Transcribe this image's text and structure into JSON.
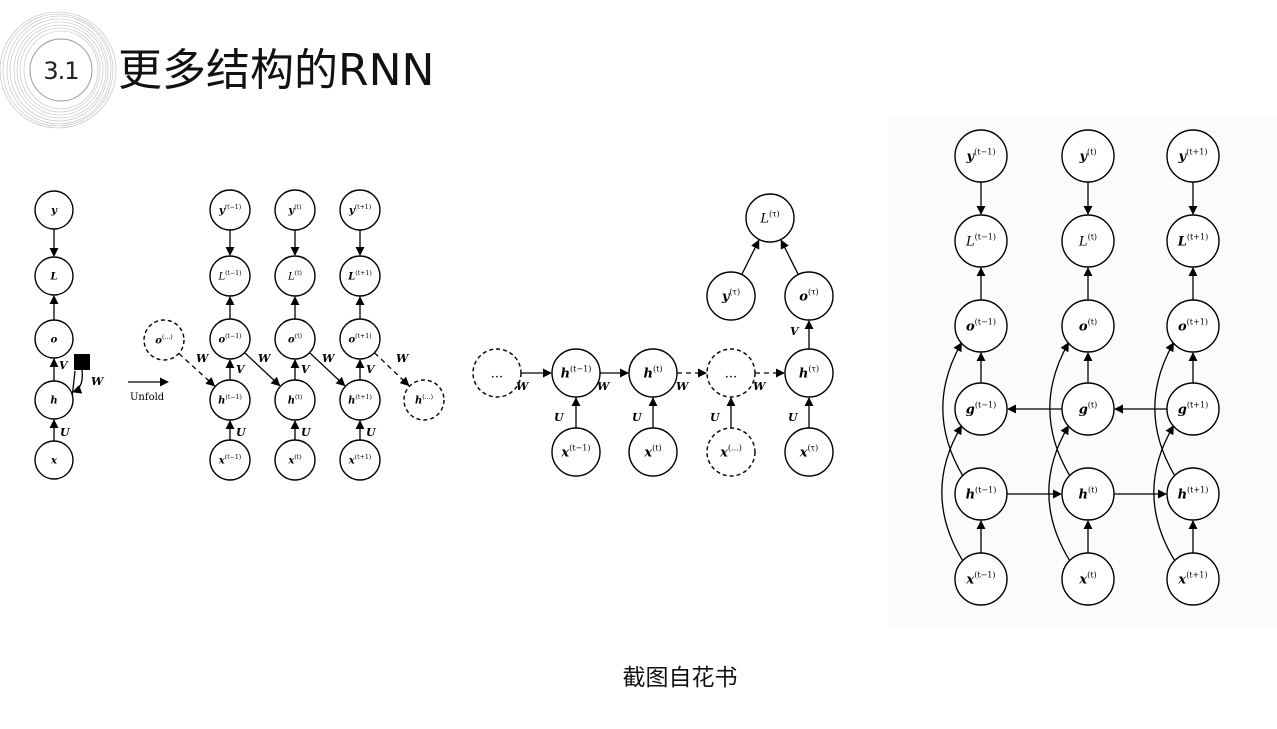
{
  "header": {
    "section_number": "3.1",
    "title": "更多结构的RNN"
  },
  "caption": "截图自花书",
  "diagram1": {
    "folded": {
      "nodes": [
        {
          "id": "f-y",
          "label": "y"
        },
        {
          "id": "f-L",
          "label": "L"
        },
        {
          "id": "f-o",
          "label": "o"
        },
        {
          "id": "f-h",
          "label": "h"
        },
        {
          "id": "f-x",
          "label": "x"
        }
      ],
      "weights": {
        "V": "V",
        "W": "W",
        "U": "U"
      }
    },
    "unfold_label": "Unfold",
    "unfolded": {
      "nodes": [
        {
          "id": "u-o-dots",
          "label": "o",
          "sup": "(...)"
        },
        {
          "id": "u-y1",
          "label": "y",
          "sup": "(t−1)"
        },
        {
          "id": "u-L1",
          "label": "L",
          "sup": "(t−1)"
        },
        {
          "id": "u-o1",
          "label": "o",
          "sup": "(t−1)"
        },
        {
          "id": "u-h1",
          "label": "h",
          "sup": "(t−1)"
        },
        {
          "id": "u-x1",
          "label": "x",
          "sup": "(t−1)"
        },
        {
          "id": "u-y2",
          "label": "y",
          "sup": "(t)"
        },
        {
          "id": "u-L2",
          "label": "L",
          "sup": "(t)"
        },
        {
          "id": "u-o2",
          "label": "o",
          "sup": "(t)"
        },
        {
          "id": "u-h2",
          "label": "h",
          "sup": "(t)"
        },
        {
          "id": "u-x2",
          "label": "x",
          "sup": "(t)"
        },
        {
          "id": "u-y3",
          "label": "y",
          "sup": "(t+1)"
        },
        {
          "id": "u-L3",
          "label": "L",
          "sup": "(t+1)"
        },
        {
          "id": "u-o3",
          "label": "o",
          "sup": "(t+1)"
        },
        {
          "id": "u-h3",
          "label": "h",
          "sup": "(t+1)"
        },
        {
          "id": "u-x3",
          "label": "x",
          "sup": "(t+1)"
        },
        {
          "id": "u-h-dots",
          "label": "h",
          "sup": "(...)"
        }
      ],
      "edge_labels": [
        "W",
        "V",
        "U",
        "W",
        "V",
        "U",
        "W",
        "V",
        "U",
        "W"
      ]
    }
  },
  "diagram2": {
    "nodes": [
      {
        "id": "s-dots-left",
        "label": "...",
        "sup": ""
      },
      {
        "id": "s-h1",
        "label": "h",
        "sup": "(t−1)"
      },
      {
        "id": "s-h2",
        "label": "h",
        "sup": "(t)"
      },
      {
        "id": "s-dots-mid",
        "label": "...",
        "sup": ""
      },
      {
        "id": "s-hT",
        "label": "h",
        "sup": "(τ)"
      },
      {
        "id": "s-x1",
        "label": "x",
        "sup": "(t−1)"
      },
      {
        "id": "s-x2",
        "label": "x",
        "sup": "(t)"
      },
      {
        "id": "s-x-dots",
        "label": "x",
        "sup": "(...)"
      },
      {
        "id": "s-xT",
        "label": "x",
        "sup": "(τ)"
      },
      {
        "id": "s-oT",
        "label": "o",
        "sup": "(τ)"
      },
      {
        "id": "s-yT",
        "label": "y",
        "sup": "(τ)"
      },
      {
        "id": "s-LT",
        "label": "L",
        "sup": "(τ)"
      }
    ],
    "edge_labels": [
      "W",
      "W",
      "W",
      "W",
      "U",
      "U",
      "U",
      "U",
      "V"
    ]
  },
  "diagram3": {
    "nodes": [
      {
        "id": "b-y1",
        "label": "y",
        "sup": "(t−1)"
      },
      {
        "id": "b-y2",
        "label": "y",
        "sup": "(t)"
      },
      {
        "id": "b-y3",
        "label": "y",
        "sup": "(t+1)"
      },
      {
        "id": "b-L1",
        "label": "L",
        "sup": "(t−1)"
      },
      {
        "id": "b-L2",
        "label": "L",
        "sup": "(t)"
      },
      {
        "id": "b-L3",
        "label": "L",
        "sup": "(t+1)"
      },
      {
        "id": "b-o1",
        "label": "o",
        "sup": "(t−1)"
      },
      {
        "id": "b-o2",
        "label": "o",
        "sup": "(t)"
      },
      {
        "id": "b-o3",
        "label": "o",
        "sup": "(t+1)"
      },
      {
        "id": "b-g1",
        "label": "g",
        "sup": "(t−1)"
      },
      {
        "id": "b-g2",
        "label": "g",
        "sup": "(t)"
      },
      {
        "id": "b-g3",
        "label": "g",
        "sup": "(t+1)"
      },
      {
        "id": "b-h1",
        "label": "h",
        "sup": "(t−1)"
      },
      {
        "id": "b-h2",
        "label": "h",
        "sup": "(t)"
      },
      {
        "id": "b-h3",
        "label": "h",
        "sup": "(t+1)"
      },
      {
        "id": "b-x1",
        "label": "x",
        "sup": "(t−1)"
      },
      {
        "id": "b-x2",
        "label": "x",
        "sup": "(t)"
      },
      {
        "id": "b-x3",
        "label": "x",
        "sup": "(t+1)"
      }
    ]
  }
}
